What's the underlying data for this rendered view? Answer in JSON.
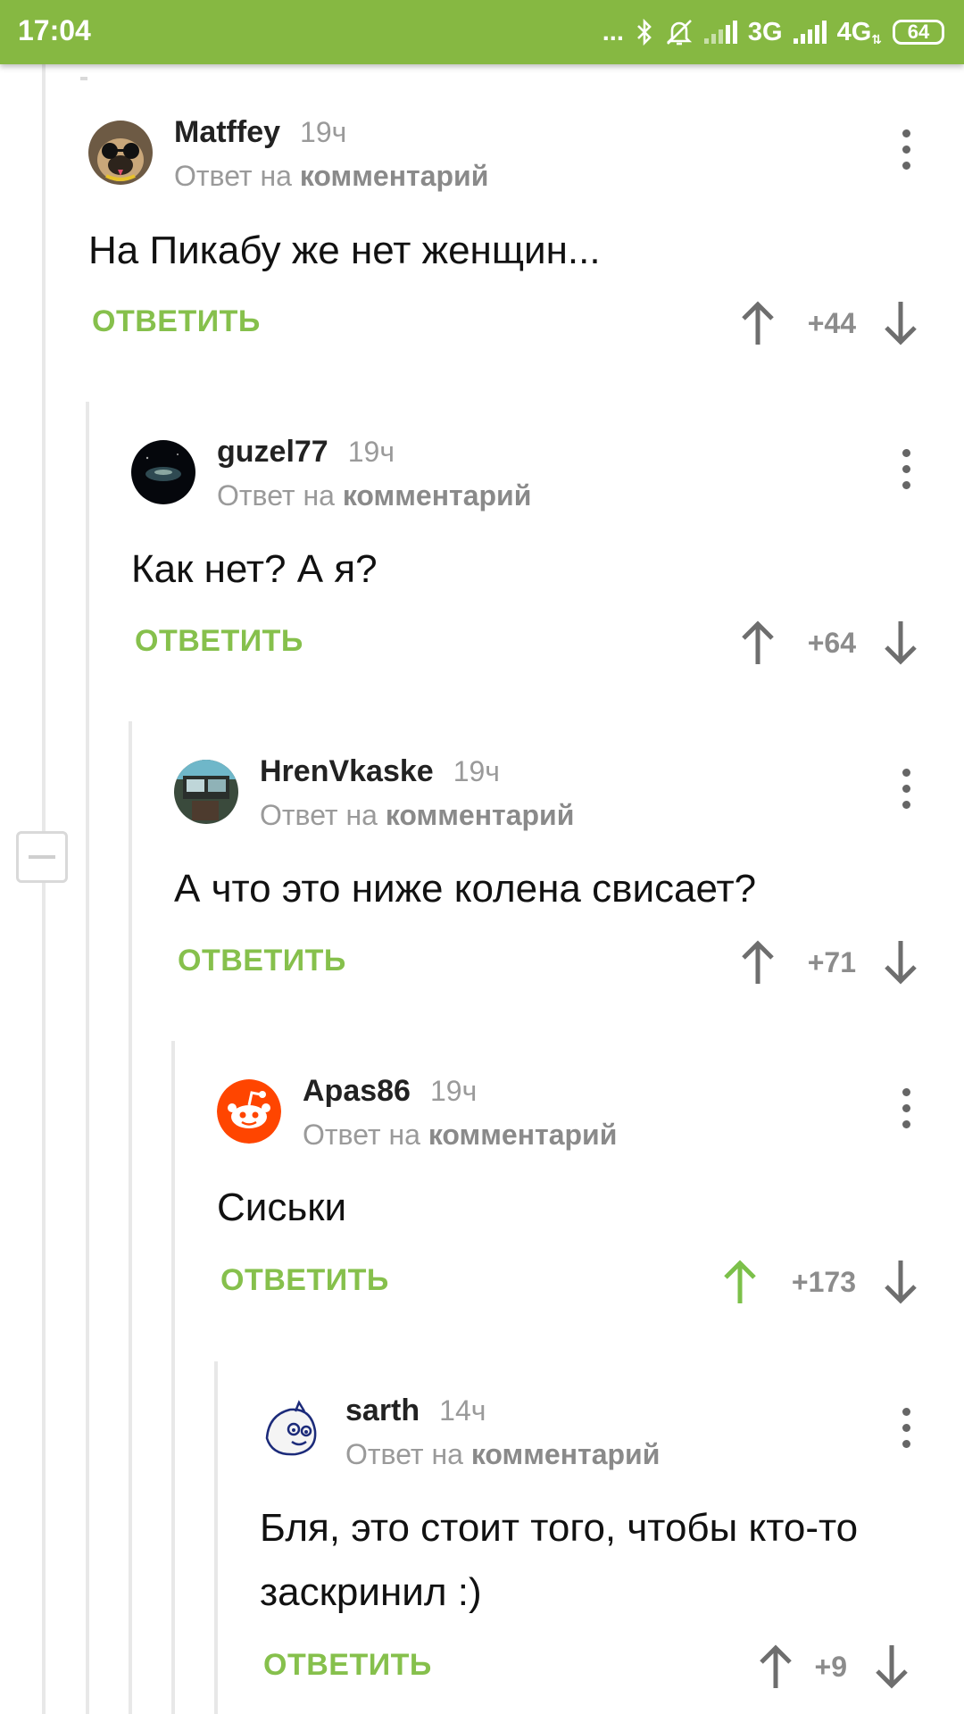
{
  "status_bar": {
    "time": "17:04",
    "dots": "...",
    "network1": "3G",
    "network2": "4G",
    "battery": "64",
    "colors": {
      "background": "#86b842"
    }
  },
  "reply_prefix": "Ответ на",
  "reply_target": "комментарий",
  "reply_label": "ОТВЕТИТЬ",
  "colors": {
    "accent": "#86c04c",
    "upvoted": "#7cc04a",
    "neutral_arrow": "#6e6e6e"
  },
  "comments": [
    {
      "author": "Matffey",
      "time": "19ч",
      "text": "На Пикабу же нет женщин...",
      "score": "+44",
      "upvoted": false,
      "avatar": "pug-avatar"
    },
    {
      "author": "guzel77",
      "time": "19ч",
      "text": "Как нет? А я?",
      "score": "+64",
      "upvoted": false,
      "avatar": "night-sky-avatar"
    },
    {
      "author": "HrenVkaske",
      "time": "19ч",
      "text": "А что это ниже колена свисает?",
      "score": "+71",
      "upvoted": false,
      "avatar": "photo-avatar"
    },
    {
      "author": "Apas86",
      "time": "19ч",
      "text": "Сиськи",
      "score": "+173",
      "upvoted": true,
      "avatar": "reddit-alien-avatar"
    },
    {
      "author": "sarth",
      "time": "14ч",
      "text_line1": "Бля, это стоит того, чтобы кто-то",
      "text_line2": "заскринил :)",
      "score": "+9",
      "upvoted": false,
      "avatar": "cartoon-cat-avatar"
    }
  ]
}
